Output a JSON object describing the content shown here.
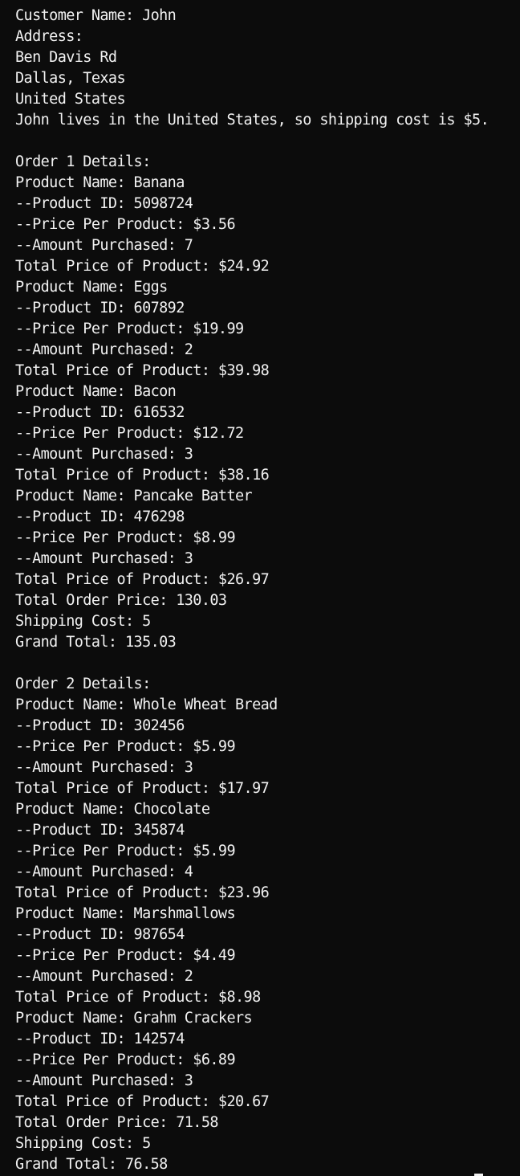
{
  "console": {
    "lines": [
      "Customer Name: John",
      "Address:",
      "Ben Davis Rd",
      "Dallas, Texas",
      "United States",
      "John lives in the United States, so shipping cost is $5.",
      "",
      "Order 1 Details:",
      "Product Name: Banana",
      "--Product ID: 5098724",
      "--Price Per Product: $3.56",
      "--Amount Purchased: 7",
      "Total Price of Product: $24.92",
      "Product Name: Eggs",
      "--Product ID: 607892",
      "--Price Per Product: $19.99",
      "--Amount Purchased: 2",
      "Total Price of Product: $39.98",
      "Product Name: Bacon",
      "--Product ID: 616532",
      "--Price Per Product: $12.72",
      "--Amount Purchased: 3",
      "Total Price of Product: $38.16",
      "Product Name: Pancake Batter",
      "--Product ID: 476298",
      "--Price Per Product: $8.99",
      "--Amount Purchased: 3",
      "Total Price of Product: $26.97",
      "Total Order Price: 130.03",
      "Shipping Cost: 5",
      "Grand Total: 135.03",
      "",
      "Order 2 Details:",
      "Product Name: Whole Wheat Bread",
      "--Product ID: 302456",
      "--Price Per Product: $5.99",
      "--Amount Purchased: 3",
      "Total Price of Product: $17.97",
      "Product Name: Chocolate",
      "--Product ID: 345874",
      "--Price Per Product: $5.99",
      "--Amount Purchased: 4",
      "Total Price of Product: $23.96",
      "Product Name: Marshmallows",
      "--Product ID: 987654",
      "--Price Per Product: $4.49",
      "--Amount Purchased: 2",
      "Total Price of Product: $8.98",
      "Product Name: Grahm Crackers",
      "--Product ID: 142574",
      "--Price Per Product: $6.89",
      "--Amount Purchased: 3",
      "Total Price of Product: $20.67",
      "Total Order Price: 71.58",
      "Shipping Cost: 5",
      "Grand Total: 76.58"
    ]
  },
  "colors": {
    "background": "#0c0c0c",
    "foreground": "#f2f2f2"
  }
}
